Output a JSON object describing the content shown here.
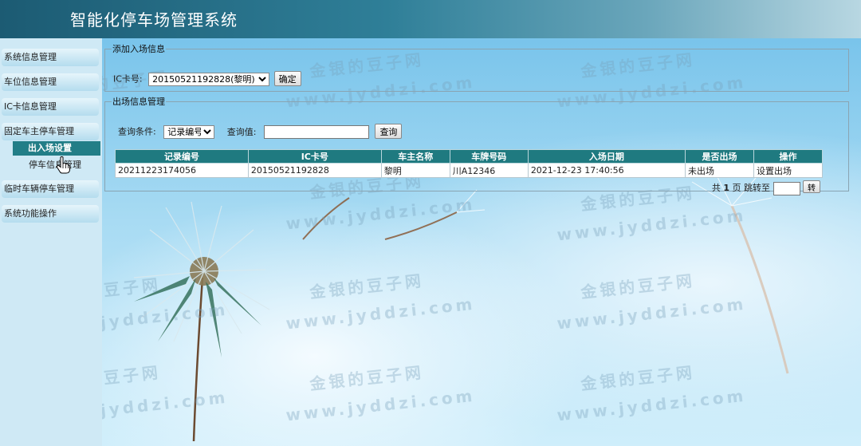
{
  "header": {
    "title": "智能化停车场管理系统"
  },
  "sidebar": {
    "items": [
      {
        "label": "系统信息管理"
      },
      {
        "label": "车位信息管理"
      },
      {
        "label": "IC卡信息管理"
      },
      {
        "label": "固定车主停车管理"
      },
      {
        "label": "临时车辆停车管理"
      },
      {
        "label": "系统功能操作"
      }
    ],
    "sub_items": [
      {
        "label": "出入场设置",
        "active": true
      },
      {
        "label": "停车信息管理",
        "active": false
      }
    ]
  },
  "add_entry": {
    "legend": "添加入场信息",
    "ic_label": "IC卡号:",
    "ic_selected": "20150521192828(黎明)",
    "confirm_label": "确定"
  },
  "exit_mgmt": {
    "legend": "出场信息管理",
    "query_condition_label": "查询条件:",
    "query_condition_selected": "记录编号",
    "query_value_label": "查询值:",
    "query_value": "",
    "query_button": "查询",
    "table": {
      "headers": [
        "记录编号",
        "IC卡号",
        "车主名称",
        "车牌号码",
        "入场日期",
        "是否出场",
        "操作"
      ],
      "rows": [
        [
          "20211223174056",
          "20150521192828",
          "黎明",
          "川A12346",
          "2021-12-23 17:40:56",
          "未出场",
          "设置出场"
        ]
      ]
    },
    "pager": {
      "prefix": "共",
      "total_pages": "1",
      "suffix": "页 跳转至",
      "go_button": "转"
    }
  },
  "watermark": {
    "text_cn": "金银的豆子网",
    "text_en": "www.jyddzi.com"
  },
  "colors": {
    "header_dark": "#1c5b73",
    "sidebar_bg": "#cfe9f5",
    "table_header": "#1f7a80",
    "active_menu": "#227e87"
  }
}
